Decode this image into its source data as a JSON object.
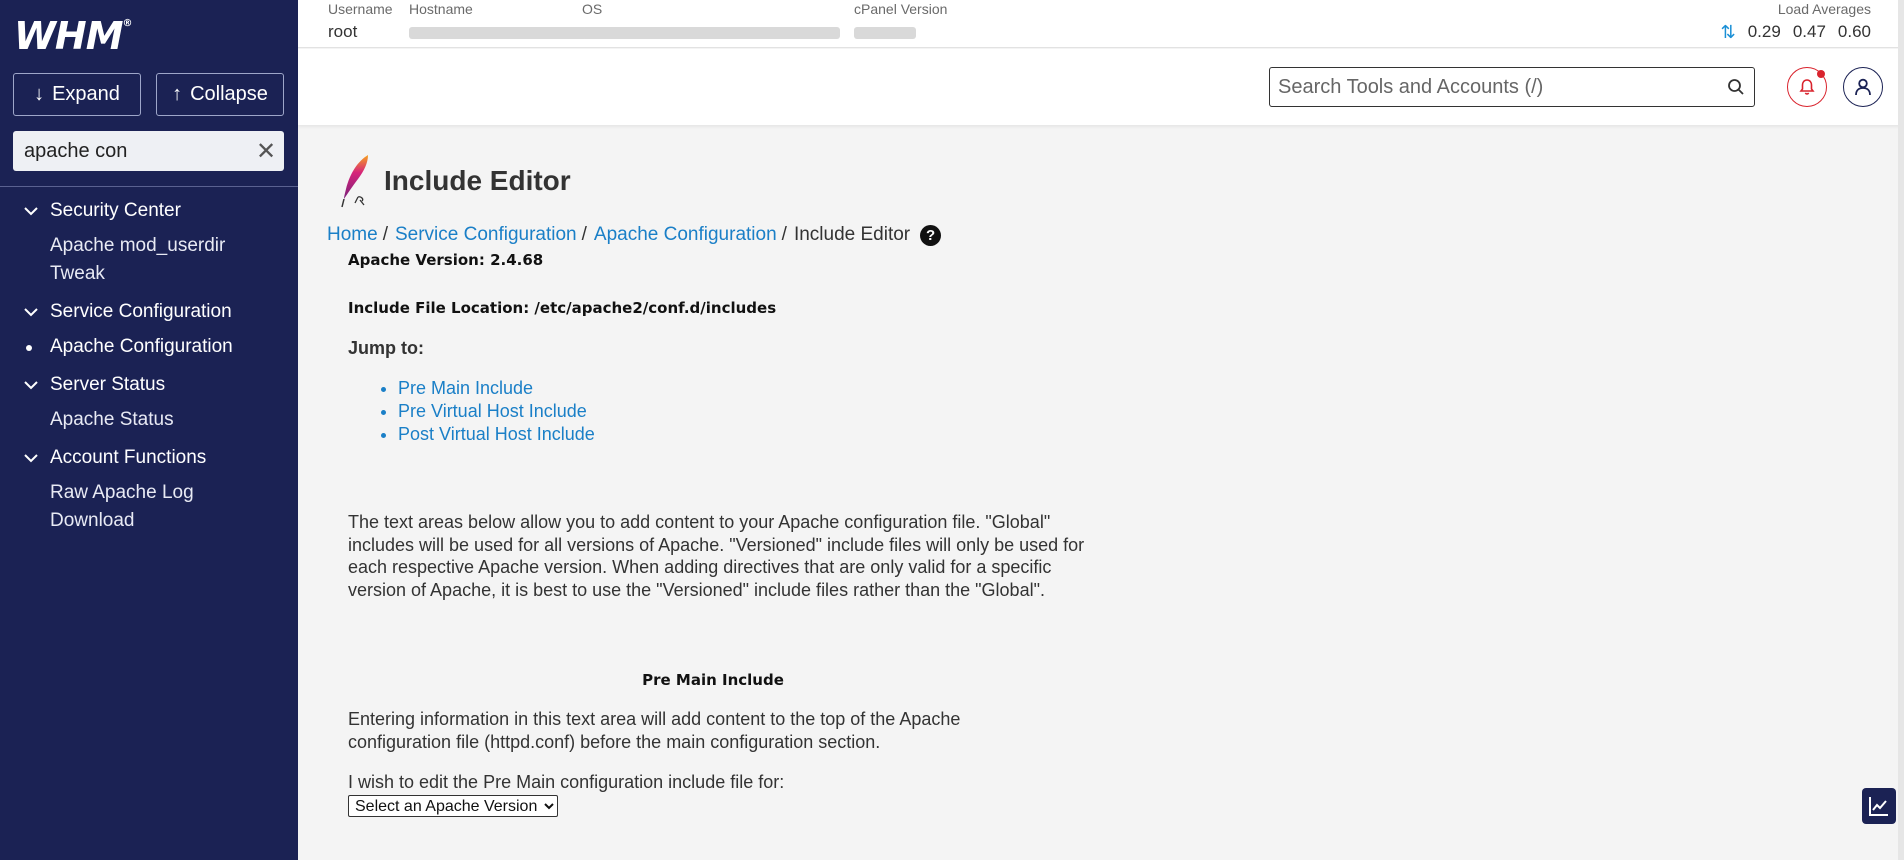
{
  "sidebar": {
    "logo": "WHM",
    "expand_label": "Expand",
    "collapse_label": "Collapse",
    "search_value": "apache con",
    "groups": [
      {
        "label": "Security Center",
        "items": [
          {
            "label_line1": "Apache mod_userdir",
            "label_line2": "Tweak"
          }
        ]
      },
      {
        "label": "Service Configuration",
        "items": [
          {
            "label_line1": "Apache Configuration"
          }
        ]
      },
      {
        "label": "Server Status",
        "items": [
          {
            "label_line1": "Apache Status"
          }
        ]
      },
      {
        "label": "Account Functions",
        "items": [
          {
            "label_line1": "Raw Apache Log",
            "label_line2": "Download"
          }
        ]
      }
    ]
  },
  "topbar": {
    "username_label": "Username",
    "username_value": "root",
    "hostname_label": "Hostname",
    "os_label": "OS",
    "cpanel_label": "cPanel Version",
    "load_label": "Load Averages",
    "load_values": [
      "0.29",
      "0.47",
      "0.60"
    ]
  },
  "header": {
    "search_placeholder": "Search Tools and Accounts (/)"
  },
  "page": {
    "title": "Include Editor",
    "breadcrumb": [
      "Home",
      "Service Configuration",
      "Apache Configuration",
      "Include Editor"
    ],
    "apache_version": "Apache Version: 2.4.68",
    "include_location": "Include File Location: /etc/apache2/conf.d/includes",
    "jump_to": "Jump to:",
    "jump_links": [
      "Pre Main Include",
      "Pre Virtual Host Include",
      "Post Virtual Host Include"
    ],
    "intro_text": "The text areas below allow you to add content to your Apache configuration file. \"Global\" includes will be used for all versions of Apache. \"Versioned\" include files will only be used for each respective Apache version. When adding directives that are only valid for a specific version of Apache, it is best to use the \"Versioned\" include files rather than the \"Global\".",
    "section_title": "Pre Main Include",
    "section_text": "Entering information in this text area will add content to the top of the Apache configuration file (httpd.conf) before the main configuration section.",
    "select_prompt": "I wish to edit the Pre Main configuration include file for:",
    "select_value": "Select an Apache Version"
  },
  "colors": {
    "sidebar_bg": "#1b2254",
    "link": "#1a7fc7",
    "alert": "#d9232d"
  }
}
